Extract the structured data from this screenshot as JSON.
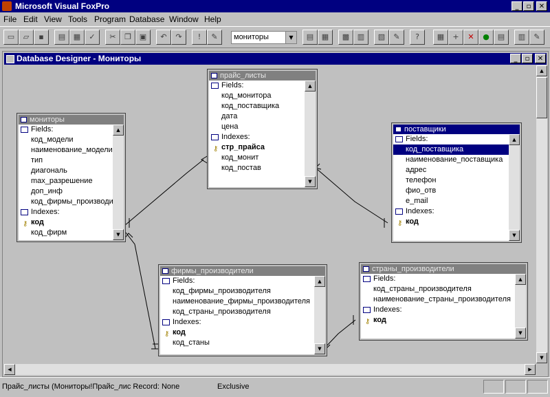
{
  "app": {
    "title": "Microsoft Visual FoxPro"
  },
  "window_controls": {
    "minimize": "_",
    "restore": "▫",
    "close": "✕"
  },
  "menu": [
    "File",
    "Edit",
    "View",
    "Tools",
    "Program",
    "Database",
    "Window",
    "Help"
  ],
  "toolbar": {
    "database_combo": "мониторы",
    "buttons_left": [
      "new-icon",
      "open-icon",
      "save-icon",
      "print-icon",
      "print-preview-icon",
      "spell-check-icon",
      "cut-icon",
      "copy-icon",
      "paste-icon",
      "undo-icon",
      "redo-icon",
      "run-icon",
      "modify-form-icon"
    ],
    "buttons_right": [
      "command-window-icon",
      "view-window-icon",
      "form-designer-icon",
      "report-designer-icon",
      "expression-builder-icon",
      "wizard-icon",
      "help-icon"
    ],
    "designer_buttons": [
      "new-table-icon",
      "add-table-icon",
      "remove-table-icon",
      "add-view-icon",
      "modify-table-icon",
      "browse-table-icon",
      "edit-procedures-icon"
    ]
  },
  "designer": {
    "title": "Database Designer - Мониторы"
  },
  "tables": [
    {
      "name": "мониторы",
      "active": false,
      "rows": [
        {
          "kind": "sec",
          "text": "Fields:"
        },
        {
          "kind": "fld",
          "text": "код_модели"
        },
        {
          "kind": "fld",
          "text": "наименование_модели"
        },
        {
          "kind": "fld",
          "text": "тип"
        },
        {
          "kind": "fld",
          "text": "диагональ"
        },
        {
          "kind": "fld",
          "text": "max_разрешение"
        },
        {
          "kind": "fld",
          "text": "доп_инф"
        },
        {
          "kind": "fld",
          "text": "код_фирмы_производи"
        },
        {
          "kind": "sec",
          "text": "Indexes:"
        },
        {
          "kind": "key",
          "text": "код"
        },
        {
          "kind": "fld",
          "text": "код_фирм"
        }
      ]
    },
    {
      "name": "прайс_листы",
      "active": false,
      "rows": [
        {
          "kind": "sec",
          "text": "Fields:"
        },
        {
          "kind": "fld",
          "text": "код_монитора"
        },
        {
          "kind": "fld",
          "text": "код_поставщика"
        },
        {
          "kind": "fld",
          "text": "дата"
        },
        {
          "kind": "fld",
          "text": "цена"
        },
        {
          "kind": "sec",
          "text": "Indexes:"
        },
        {
          "kind": "key",
          "text": "стр_прайса"
        },
        {
          "kind": "fld",
          "text": "код_монит"
        },
        {
          "kind": "fld",
          "text": "код_постав"
        }
      ]
    },
    {
      "name": "поставщики",
      "active": true,
      "rows": [
        {
          "kind": "sec",
          "text": "Fields:"
        },
        {
          "kind": "sel",
          "text": "код_поставщика"
        },
        {
          "kind": "fld",
          "text": "наименование_поставщика"
        },
        {
          "kind": "fld",
          "text": "адрес"
        },
        {
          "kind": "fld",
          "text": "телефон"
        },
        {
          "kind": "fld",
          "text": "фио_отв"
        },
        {
          "kind": "fld",
          "text": "e_mail"
        },
        {
          "kind": "sec",
          "text": "Indexes:"
        },
        {
          "kind": "key",
          "text": "код"
        }
      ]
    },
    {
      "name": "фирмы_производители",
      "active": false,
      "rows": [
        {
          "kind": "sec",
          "text": "Fields:"
        },
        {
          "kind": "fld",
          "text": "код_фирмы_производителя"
        },
        {
          "kind": "fld",
          "text": "наименование_фирмы_производителя"
        },
        {
          "kind": "fld",
          "text": "код_страны_производителя"
        },
        {
          "kind": "sec",
          "text": "Indexes:"
        },
        {
          "kind": "key",
          "text": "код"
        },
        {
          "kind": "fld",
          "text": "код_станы"
        }
      ]
    },
    {
      "name": "страны_производители",
      "active": false,
      "rows": [
        {
          "kind": "sec",
          "text": "Fields:"
        },
        {
          "kind": "fld",
          "text": "код_страны_производителя"
        },
        {
          "kind": "fld",
          "text": "наименование_страны_производителя"
        },
        {
          "kind": "sec",
          "text": "Indexes:"
        },
        {
          "kind": "key",
          "text": "код"
        }
      ]
    }
  ],
  "status": {
    "message": "Прайс_листы (Мониторы!Прайс_лис Record: None",
    "mode": "Exclusive"
  }
}
